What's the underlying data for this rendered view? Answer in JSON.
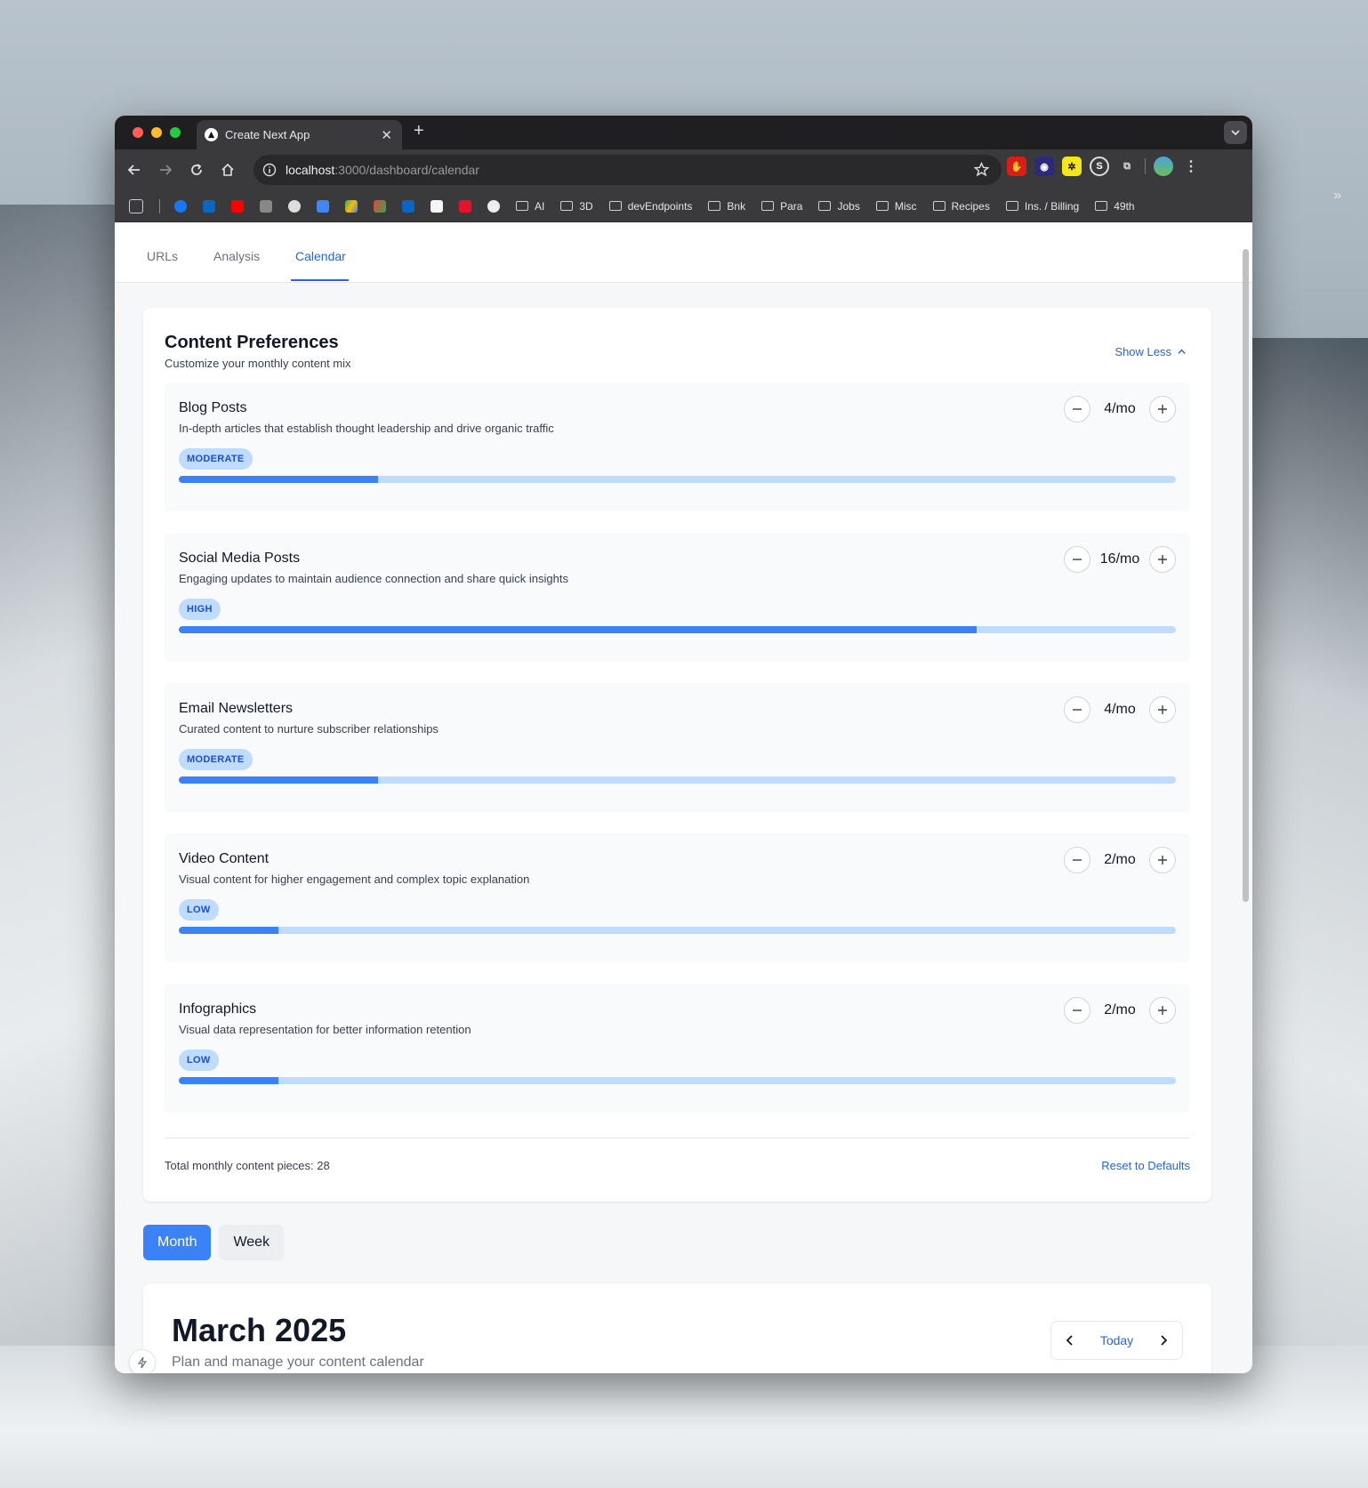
{
  "browser": {
    "tab_title": "Create Next App",
    "url_host": "localhost",
    "url_path": ":3000/dashboard/calendar",
    "bookmark_folders": [
      "AI",
      "3D",
      "devEndpoints",
      "Bnk",
      "Para",
      "Jobs",
      "Misc",
      "Recipes",
      "Ins. / Billing",
      "49th"
    ]
  },
  "nav_tabs": [
    "URLs",
    "Analysis",
    "Calendar"
  ],
  "active_tab": "Calendar",
  "preferences": {
    "title": "Content Preferences",
    "subtitle": "Customize your monthly content mix",
    "toggle_label": "Show Less",
    "items": [
      {
        "name": "Blog Posts",
        "description": "In-depth articles that establish thought leadership and drive organic traffic",
        "level": "MODERATE",
        "count": "4/mo",
        "fill_fraction": 0.2
      },
      {
        "name": "Social Media Posts",
        "description": "Engaging updates to maintain audience connection and share quick insights",
        "level": "HIGH",
        "count": "16/mo",
        "fill_fraction": 0.8
      },
      {
        "name": "Email Newsletters",
        "description": "Curated content to nurture subscriber relationships",
        "level": "MODERATE",
        "count": "4/mo",
        "fill_fraction": 0.2
      },
      {
        "name": "Video Content",
        "description": "Visual content for higher engagement and complex topic explanation",
        "level": "LOW",
        "count": "2/mo",
        "fill_fraction": 0.1
      },
      {
        "name": "Infographics",
        "description": "Visual data representation for better information retention",
        "level": "LOW",
        "count": "2/mo",
        "fill_fraction": 0.1
      }
    ],
    "total_label": "Total monthly content pieces: 28",
    "reset_label": "Reset to Defaults"
  },
  "view_toggle": {
    "month": "Month",
    "week": "Week",
    "selected": "Month"
  },
  "calendar": {
    "title": "March 2025",
    "subtitle": "Plan and manage your content calendar",
    "today_label": "Today"
  },
  "colors": {
    "accent": "#2563eb",
    "accent_fill": "#3b82f6",
    "badge_bg": "#bfdbfe"
  }
}
